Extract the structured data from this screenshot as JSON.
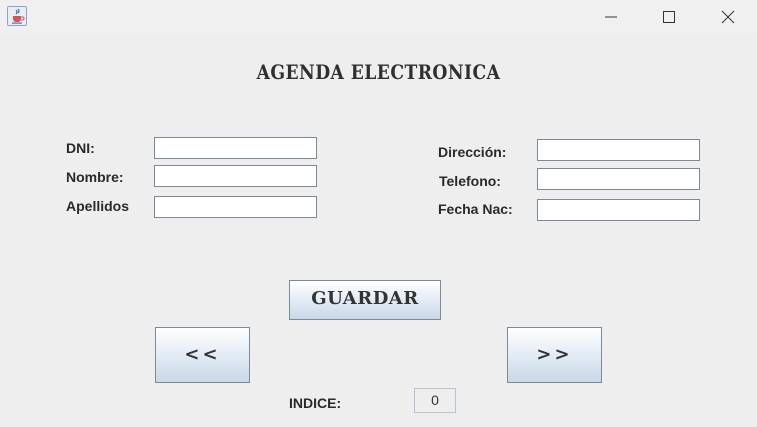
{
  "window": {
    "icon": "java-cup-icon",
    "controls": {
      "minimize": "minimize-icon",
      "maximize": "maximize-icon",
      "close": "close-icon"
    }
  },
  "form": {
    "title": "AGENDA ELECTRONICA",
    "left_fields": [
      {
        "label": "DNI:",
        "value": ""
      },
      {
        "label": "Nombre:",
        "value": ""
      },
      {
        "label": "Apellidos",
        "value": ""
      }
    ],
    "right_fields": [
      {
        "label": "Dirección:",
        "value": ""
      },
      {
        "label": "Telefono:",
        "value": ""
      },
      {
        "label": "Fecha Nac:",
        "value": ""
      }
    ],
    "save_label": "GUARDAR",
    "prev_label": "<<",
    "next_label": ">>",
    "index_label": "INDICE:",
    "index_value": "0"
  },
  "colors": {
    "background": "#eeeeee",
    "button_gradient_top": "#ffffff",
    "button_gradient_bottom": "#c8d7e8",
    "field_border": "#7a8a99"
  }
}
